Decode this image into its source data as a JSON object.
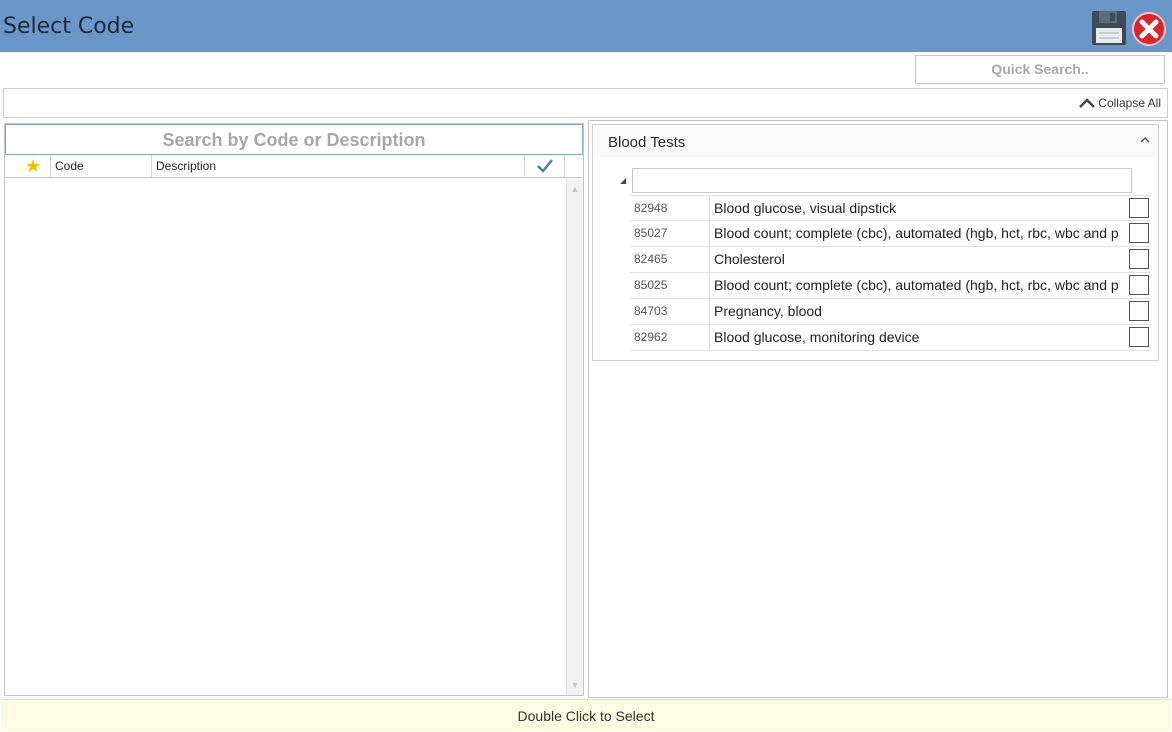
{
  "window": {
    "title": "Select Code"
  },
  "toolbar": {
    "save_icon": "floppy-disk-icon",
    "close_icon": "red-x-close-icon"
  },
  "quick_search": {
    "placeholder": "Quick Search.."
  },
  "collapse": {
    "label": "Collapse All",
    "icon": "chevron-up-icon"
  },
  "left_grid": {
    "search_placeholder": "Search by Code or Description",
    "columns": {
      "favorite_icon": "star-icon",
      "code": "Code",
      "description": "Description",
      "check_icon": "checkmark-icon"
    },
    "rows": []
  },
  "group": {
    "title": "Blood Tests",
    "rows": [
      {
        "code": "82948",
        "description": "Blood glucose, visual dipstick",
        "checked": false
      },
      {
        "code": "85027",
        "description": "Blood count; complete (cbc), automated (hgb, hct, rbc, wbc and p",
        "checked": false
      },
      {
        "code": "82465",
        "description": "Cholesterol",
        "checked": false
      },
      {
        "code": "85025",
        "description": "Blood count; complete (cbc), automated (hgb, hct, rbc, wbc and p",
        "checked": false
      },
      {
        "code": "84703",
        "description": "Pregnancy, blood",
        "checked": false
      },
      {
        "code": "82962",
        "description": "Blood glucose, monitoring device",
        "checked": false
      }
    ]
  },
  "footer": {
    "hint": "Double Click to Select"
  }
}
